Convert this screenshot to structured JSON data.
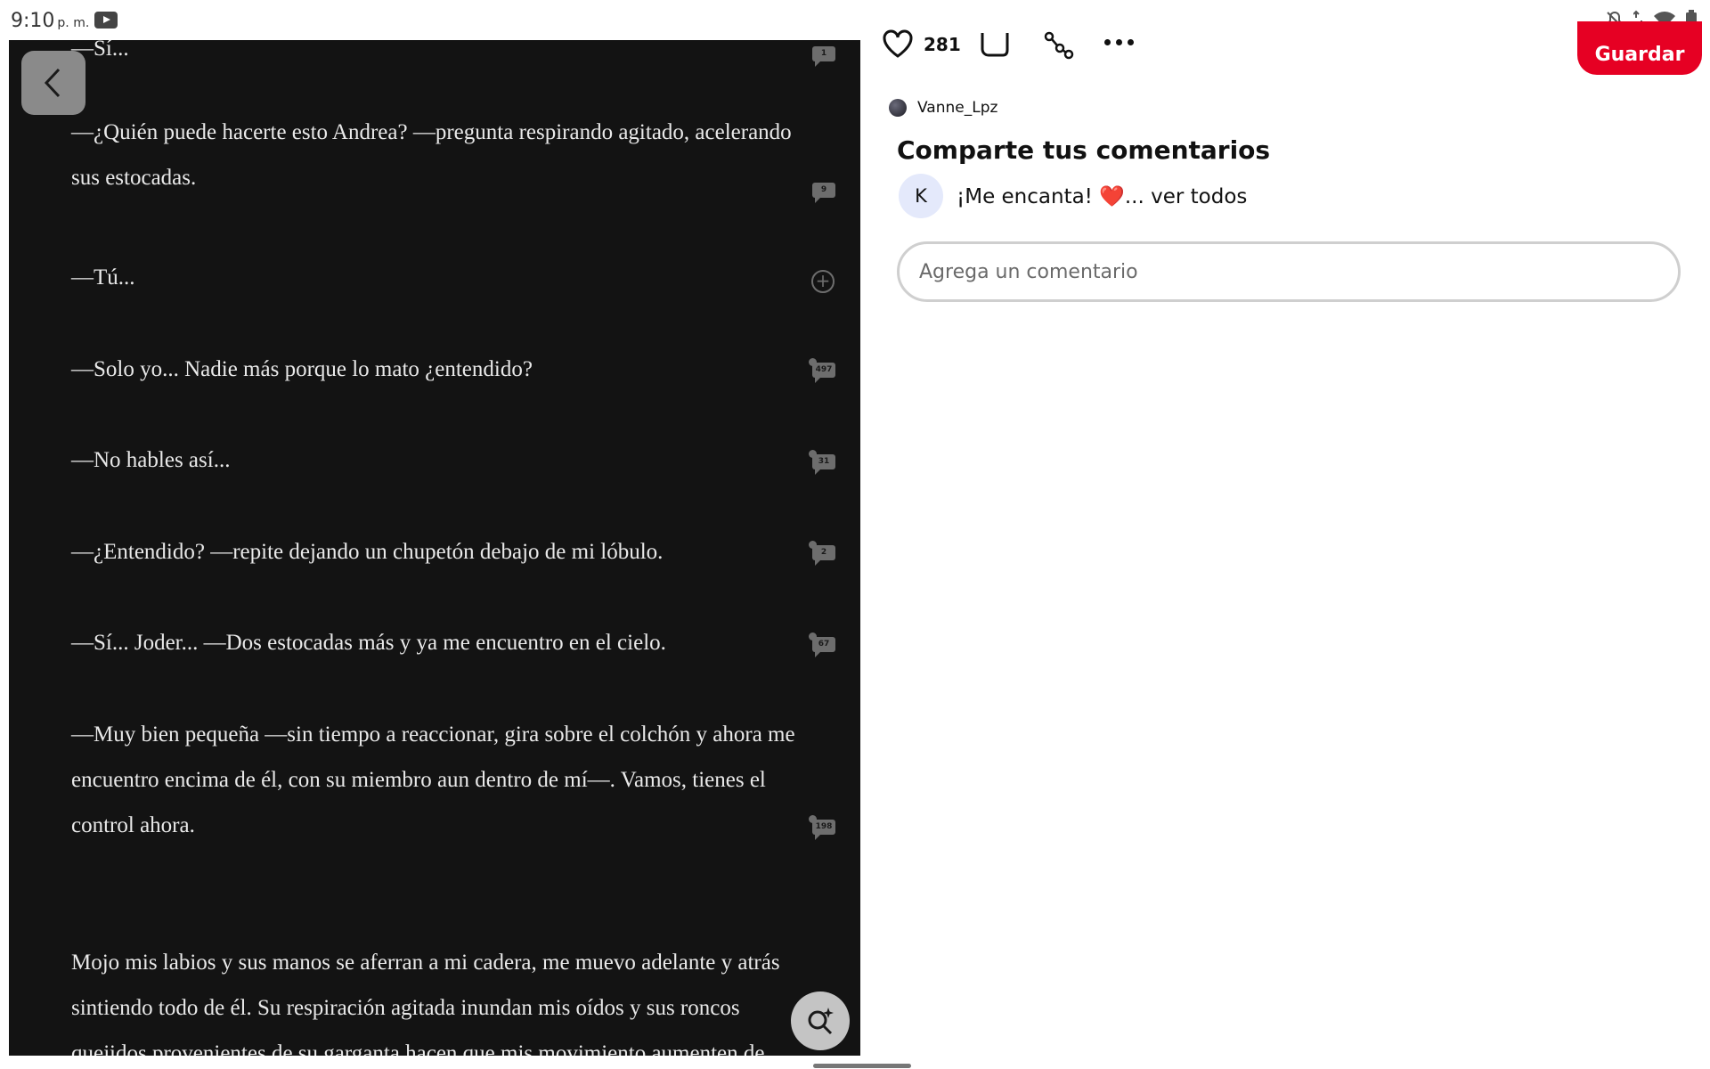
{
  "status_bar": {
    "time": "9:10",
    "ampm": "p. m."
  },
  "reader": {
    "paragraphs": [
      "—Sí...",
      "—¿Quién puede hacerte esto Andrea? —pregunta respirando agitado, acelerando sus estocadas.",
      "—Tú...",
      "—Solo yo... Nadie más porque lo mato ¿entendido?",
      "—No hables así...",
      "—¿Entendido? —repite dejando un chupetón debajo de mi lóbulo.",
      "—Sí... Joder... —Dos estocadas más y ya me encuentro en el cielo.",
      "—Muy bien pequeña —sin tiempo a reaccionar, gira sobre el colchón y ahora me encuentro encima de él, con su miembro aun dentro de mí—. Vamos, tienes el control ahora.",
      "Mojo mis labios y sus manos se aferran a mi cadera, me muevo adelante y atrás sintiendo todo de él. Su respiración agitada inundan mis oídos y sus roncos quejidos provenientes de su garganta hacen que mis movimiento aumenten de velocidad."
    ],
    "comment_counts": [
      "1",
      "9",
      "497",
      "31",
      "2",
      "67",
      "198"
    ]
  },
  "pin": {
    "likes": "281",
    "save_label": "Guardar",
    "author": "Vanne_Lpz",
    "comments_title": "Comparte tus comentarios",
    "comment": {
      "avatar_letter": "K",
      "text": "¡Me encanta! ",
      "emoji": "❤️",
      "see_all": "... ver todos"
    },
    "comment_placeholder": "Agrega un comentario"
  },
  "colors": {
    "reader_bg": "#131313",
    "save_red": "#e60023",
    "comment_avatar_bg": "#e4e9fb"
  }
}
